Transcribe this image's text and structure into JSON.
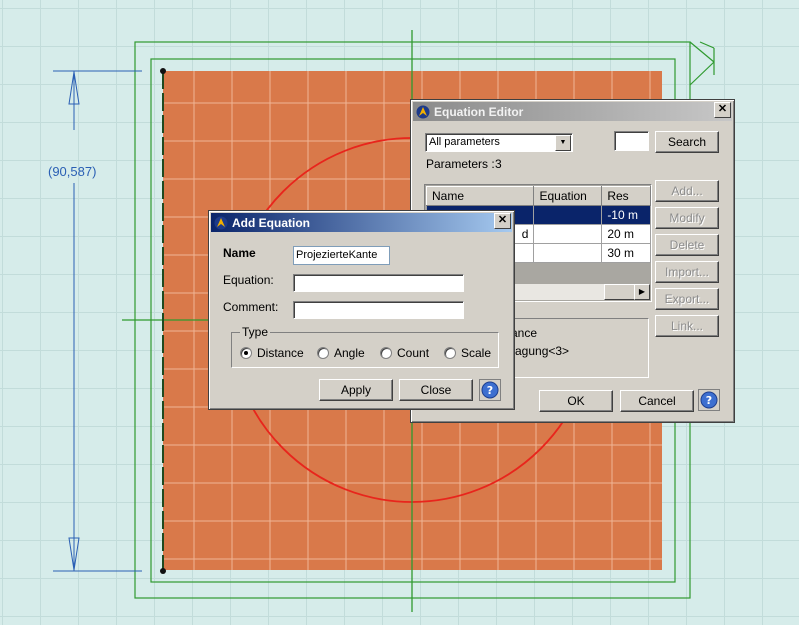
{
  "canvas": {
    "dimension_label": "(90,587)"
  },
  "equation_editor": {
    "title": "Equation Editor",
    "filter_value": "All parameters",
    "search_label": "Search",
    "parameters_label": "Parameters :",
    "parameters_count": "3",
    "columns": [
      "Name",
      "Equation",
      "Res"
    ],
    "rows": [
      {
        "name": "",
        "equation": "",
        "result": "-10 m"
      },
      {
        "name": "d",
        "equation": "",
        "result": "20 m"
      },
      {
        "name": "",
        "equation": "",
        "result": "30 m"
      }
    ],
    "side_buttons": [
      "Add...",
      "Modify",
      "Delete",
      "Import...",
      "Export...",
      "Link..."
    ],
    "description_lines": [
      "ance",
      "ragung<3>"
    ],
    "ok_label": "OK",
    "cancel_label": "Cancel"
  },
  "add_equation": {
    "title": "Add Equation",
    "name_label": "Name",
    "name_value": "ProjezierteKante",
    "equation_label": "Equation:",
    "comment_label": "Comment:",
    "type_label": "Type",
    "types": [
      {
        "label": "Distance",
        "selected": true
      },
      {
        "label": "Angle",
        "selected": false
      },
      {
        "label": "Count",
        "selected": false
      },
      {
        "label": "Scale",
        "selected": false
      }
    ],
    "apply_label": "Apply",
    "close_label": "Close"
  },
  "colors": {
    "part_fill": "#d9794a",
    "circle": "#e8251c",
    "dimension": "#2a5fb4",
    "construction": "#2f9a2f",
    "selection": "#0a246a"
  }
}
